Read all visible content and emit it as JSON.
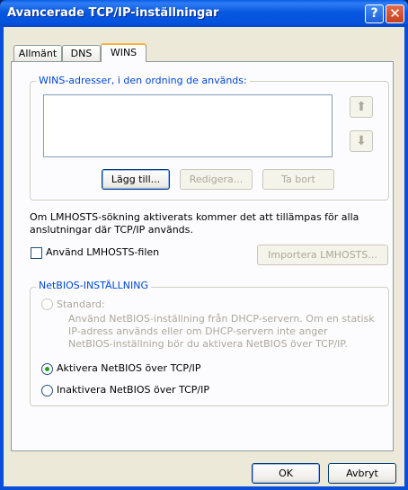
{
  "window": {
    "title": "Avancerade TCP/IP-inställningar",
    "help_glyph": "?",
    "close_glyph": "✕"
  },
  "tabs": [
    {
      "label": "Allmänt",
      "active": false
    },
    {
      "label": "DNS",
      "active": false
    },
    {
      "label": "WINS",
      "active": true
    }
  ],
  "wins": {
    "group_label": "WINS-adresser, i den ordning de används:",
    "up_glyph": "⬆",
    "down_glyph": "⬇",
    "add_label": "Lägg till...",
    "edit_label": "Redigera...",
    "remove_label": "Ta bort"
  },
  "lmhosts": {
    "info_line1": "Om LMHOSTS-sökning aktiverats kommer det att tillämpas för alla",
    "info_line2": "anslutningar där TCP/IP används.",
    "checkbox_label": "Använd LMHOSTS-filen",
    "checked": false,
    "import_label": "Importera LMHOSTS..."
  },
  "netbios": {
    "group_label": "NetBIOS-INSTÄLLNING",
    "standard_label": "Standard:",
    "standard_desc": [
      "Använd NetBIOS-inställning från DHCP-servern. Om en statisk",
      "IP-adress används eller om DHCP-servern inte anger",
      "NetBIOS-inställning bör du aktivera NetBIOS över TCP/IP."
    ],
    "enable_label": "Aktivera NetBIOS över TCP/IP",
    "disable_label": "Inaktivera NetBIOS över TCP/IP",
    "selected": "enable"
  },
  "footer": {
    "ok_label": "OK",
    "cancel_label": "Avbryt"
  }
}
